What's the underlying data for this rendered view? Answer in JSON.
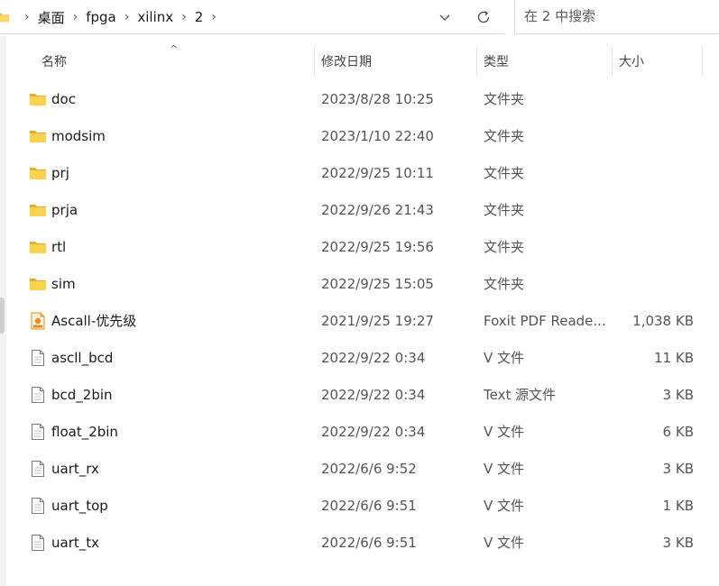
{
  "breadcrumb": {
    "items": [
      "桌面",
      "fpga",
      "xilinx",
      "2"
    ],
    "separator": "›"
  },
  "search": {
    "placeholder": "在 2 中搜索"
  },
  "columns": {
    "name": "名称",
    "date": "修改日期",
    "type": "类型",
    "size": "大小"
  },
  "sort_indicator": "^",
  "files": [
    {
      "name": "doc",
      "date": "2023/8/28 10:25",
      "type": "文件夹",
      "size": "",
      "icon": "folder-icon"
    },
    {
      "name": "modsim",
      "date": "2023/1/10 22:40",
      "type": "文件夹",
      "size": "",
      "icon": "folder-icon"
    },
    {
      "name": "prj",
      "date": "2022/9/25 10:11",
      "type": "文件夹",
      "size": "",
      "icon": "folder-icon"
    },
    {
      "name": "prja",
      "date": "2022/9/26 21:43",
      "type": "文件夹",
      "size": "",
      "icon": "folder-icon"
    },
    {
      "name": "rtl",
      "date": "2022/9/25 19:56",
      "type": "文件夹",
      "size": "",
      "icon": "folder-icon"
    },
    {
      "name": "sim",
      "date": "2022/9/25 15:05",
      "type": "文件夹",
      "size": "",
      "icon": "folder-icon"
    },
    {
      "name": "Ascall-优先级",
      "date": "2021/9/25 19:27",
      "type": "Foxit PDF Reade...",
      "size": "1,038 KB",
      "icon": "pdf-file-icon"
    },
    {
      "name": "ascll_bcd",
      "date": "2022/9/22 0:34",
      "type": "V 文件",
      "size": "11 KB",
      "icon": "file-icon"
    },
    {
      "name": "bcd_2bin",
      "date": "2022/9/22 0:34",
      "type": "Text 源文件",
      "size": "3 KB",
      "icon": "file-icon"
    },
    {
      "name": "float_2bin",
      "date": "2022/9/22 0:34",
      "type": "V 文件",
      "size": "6 KB",
      "icon": "file-icon"
    },
    {
      "name": "uart_rx",
      "date": "2022/6/6 9:52",
      "type": "V 文件",
      "size": "3 KB",
      "icon": "file-icon"
    },
    {
      "name": "uart_top",
      "date": "2022/6/6 9:51",
      "type": "V 文件",
      "size": "1 KB",
      "icon": "file-icon"
    },
    {
      "name": "uart_tx",
      "date": "2022/6/6 9:51",
      "type": "V 文件",
      "size": "3 KB",
      "icon": "file-icon"
    }
  ]
}
